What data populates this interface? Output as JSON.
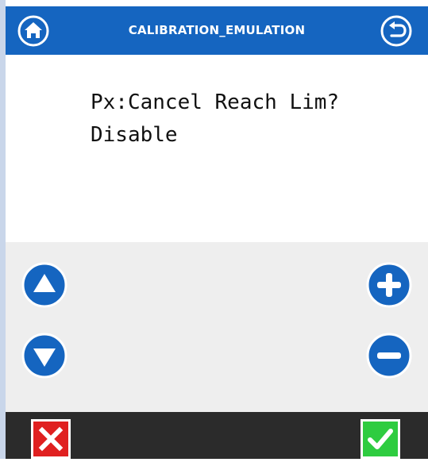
{
  "header": {
    "title": "CALIBRATION_EMULATION",
    "home_icon": "home-icon",
    "back_icon": "return-icon"
  },
  "display": {
    "line1": "Px:Cancel Reach Lim?",
    "line2": "Disable"
  },
  "controls": {
    "up_icon": "triangle-up-icon",
    "down_icon": "triangle-down-icon",
    "plus_icon": "plus-icon",
    "minus_icon": "minus-icon"
  },
  "footer": {
    "cancel_icon": "x-icon",
    "confirm_icon": "checkmark-icon"
  },
  "colors": {
    "header_bg": "#1565c0",
    "button_blue": "#1565c0",
    "footer_bg": "#2b2b2b",
    "controls_bg": "#eeeeee",
    "cancel_red": "#e02020",
    "confirm_green": "#2ecc40"
  }
}
